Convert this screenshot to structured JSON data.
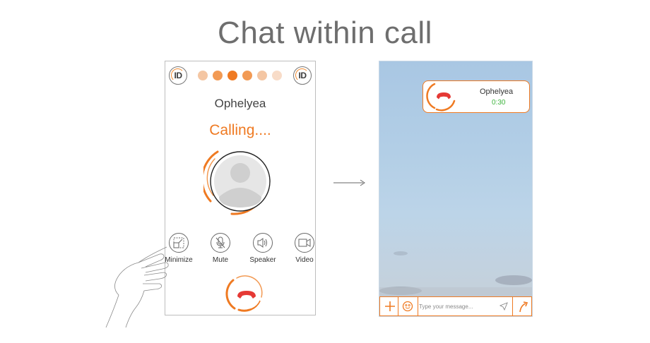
{
  "heading": "Chat within call",
  "call_screen": {
    "caller_name": "Ophelyea",
    "status": "Calling....",
    "logo_text": "ID",
    "progress_dots": [
      "#f4c6a3",
      "#f29a54",
      "#ef7a22",
      "#f29a54",
      "#f4c6a3",
      "#f8dcc8"
    ],
    "controls": [
      {
        "label": "Minimize",
        "icon": "minimize-icon"
      },
      {
        "label": "Mute",
        "icon": "microphone-icon"
      },
      {
        "label": "Speaker",
        "icon": "speaker-icon"
      },
      {
        "label": "Video",
        "icon": "video-camera-icon"
      }
    ],
    "end_call_icon": "phone-hangup-icon"
  },
  "chat_screen": {
    "call_card": {
      "name": "Ophelyea",
      "duration": "0:30"
    },
    "message_placeholder": "Type your message...",
    "icons": [
      "plus-icon",
      "emoji-icon",
      "send-icon",
      "share-icon"
    ]
  },
  "colors": {
    "accent": "#ef7a22",
    "end_call": "#e53935",
    "timer": "#3db33d"
  }
}
